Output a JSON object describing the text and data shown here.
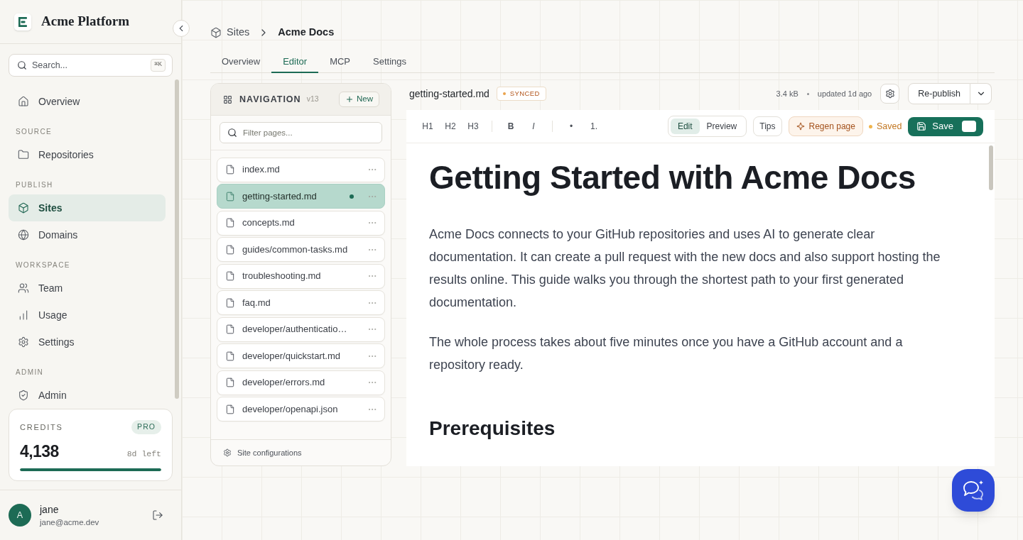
{
  "sidebar": {
    "brand": "Acme Platform",
    "search": {
      "placeholder": "Search...",
      "shortcut": "⌘K"
    },
    "sections": [
      {
        "items": [
          {
            "label": "Overview",
            "selected": false
          }
        ]
      },
      {
        "title": "SOURCE",
        "items": [
          {
            "label": "Repositories",
            "selected": false
          }
        ]
      },
      {
        "title": "PUBLISH",
        "items": [
          {
            "label": "Sites",
            "selected": true
          },
          {
            "label": "Domains",
            "selected": false
          }
        ]
      },
      {
        "title": "WORKSPACE",
        "items": [
          {
            "label": "Team",
            "selected": false
          },
          {
            "label": "Usage",
            "selected": false
          },
          {
            "label": "Settings",
            "selected": false
          }
        ]
      },
      {
        "title": "ADMIN",
        "items": [
          {
            "label": "Admin",
            "selected": false
          }
        ]
      }
    ],
    "credits": {
      "label": "CREDITS",
      "plan": "PRO",
      "amount": "4,138",
      "remaining": "8d left",
      "level": 1
    },
    "user": {
      "initial": "A",
      "name": "jane",
      "email": "jane@acme.dev"
    }
  },
  "breadcrumb": [
    {
      "label": "Sites"
    },
    {
      "label": "Acme Docs"
    }
  ],
  "tabs": [
    {
      "label": "Overview",
      "selected": false
    },
    {
      "label": "Editor",
      "selected": true
    },
    {
      "label": "MCP",
      "selected": false
    },
    {
      "label": "Settings",
      "selected": false
    }
  ],
  "navigation": {
    "title": "NAVIGATION",
    "version": "v13",
    "new_button": "New",
    "filter": {
      "placeholder": "Filter pages..."
    },
    "pages": [
      {
        "name": "index.md",
        "selected": false,
        "modified": false
      },
      {
        "name": "getting-started.md",
        "selected": true,
        "modified": true
      },
      {
        "name": "concepts.md",
        "selected": false,
        "modified": false
      },
      {
        "name": "guides/common-tasks.md",
        "selected": false,
        "modified": false
      },
      {
        "name": "troubleshooting.md",
        "selected": false,
        "modified": false
      },
      {
        "name": "faq.md",
        "selected": false,
        "modified": false
      },
      {
        "name": "developer/authenticatio…",
        "selected": false,
        "modified": false
      },
      {
        "name": "developer/quickstart.md",
        "selected": false,
        "modified": false
      },
      {
        "name": "developer/errors.md",
        "selected": false,
        "modified": false
      },
      {
        "name": "developer/openapi.json",
        "selected": false,
        "modified": false
      }
    ],
    "footer": "Site configurations"
  },
  "editor": {
    "filename": "getting-started.md",
    "sync_status": "SYNCED",
    "size": "3.4 kB",
    "updated": "updated 1d ago",
    "republish": "Re-publish",
    "toolbar": {
      "groups": [
        [
          {
            "label": "H1",
            "kind": "heading"
          },
          {
            "label": "H2",
            "kind": "heading"
          },
          {
            "label": "H3",
            "kind": "heading"
          }
        ],
        [
          {
            "label": "B",
            "kind": "bold"
          },
          {
            "label": "I",
            "kind": "italic"
          }
        ],
        [
          {
            "label": "•",
            "kind": "list"
          },
          {
            "label": "1.",
            "kind": "list"
          }
        ]
      ],
      "modes": [
        {
          "label": "Edit",
          "selected": true
        },
        {
          "label": "Preview",
          "selected": false
        }
      ],
      "tips": "Tips",
      "regen": "Regen page",
      "save_status": "Saved",
      "save": "Save"
    },
    "content": [
      {
        "kind": "h1",
        "text": "Getting Started with Acme Docs"
      },
      {
        "kind": "paragraph",
        "text": "Acme Docs connects to your GitHub repositories and uses AI to generate clear documentation. It can create a pull request with the new docs and also support hosting the results online. This guide walks you through the shortest path to your first generated documentation."
      },
      {
        "kind": "paragraph",
        "text": "The whole process takes about five minutes once you have a GitHub account and a repository ready."
      },
      {
        "kind": "h2",
        "text": "Prerequisites"
      }
    ]
  }
}
